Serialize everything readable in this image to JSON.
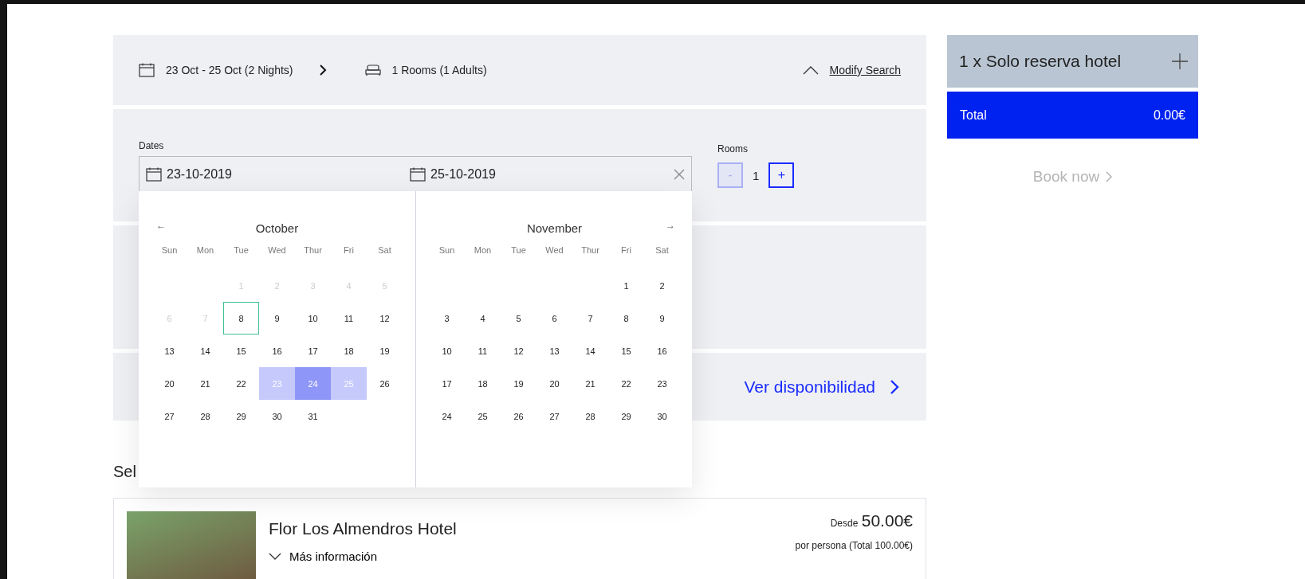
{
  "summary": {
    "dates": "23 Oct - 25 Oct (2 Nights)",
    "rooms": "1 Rooms (1 Adults)",
    "modify": "Modify Search"
  },
  "search": {
    "dates_label": "Dates",
    "start": "23-10-2019",
    "end": "25-10-2019",
    "rooms": {
      "label": "Rooms",
      "value": "1",
      "decrement": {
        "label": "-",
        "disabled": true
      },
      "increment": {
        "label": "+",
        "disabled": false
      }
    }
  },
  "calendar": {
    "months": [
      {
        "name": "October",
        "nav": {
          "label": "←",
          "kind": "prev"
        },
        "weekdays": [
          "Sun",
          "Mon",
          "Tue",
          "Wed",
          "Thur",
          "Fri",
          "Sat"
        ],
        "weeks": [
          [
            {
              "kind": "blank"
            },
            {
              "kind": "blank"
            },
            {
              "label": "1",
              "kind": "past"
            },
            {
              "label": "2",
              "kind": "past"
            },
            {
              "label": "3",
              "kind": "past"
            },
            {
              "label": "4",
              "kind": "past"
            },
            {
              "label": "5",
              "kind": "past"
            }
          ],
          [
            {
              "label": "6",
              "kind": "past"
            },
            {
              "label": "7",
              "kind": "past"
            },
            {
              "label": "8",
              "kind": "today"
            },
            {
              "label": "9",
              "kind": "day"
            },
            {
              "label": "10",
              "kind": "day"
            },
            {
              "label": "11",
              "kind": "day"
            },
            {
              "label": "12",
              "kind": "day"
            }
          ],
          [
            {
              "label": "13",
              "kind": "day"
            },
            {
              "label": "14",
              "kind": "day"
            },
            {
              "label": "15",
              "kind": "day"
            },
            {
              "label": "16",
              "kind": "day"
            },
            {
              "label": "17",
              "kind": "day"
            },
            {
              "label": "18",
              "kind": "day"
            },
            {
              "label": "19",
              "kind": "day"
            }
          ],
          [
            {
              "label": "20",
              "kind": "day"
            },
            {
              "label": "21",
              "kind": "day"
            },
            {
              "label": "22",
              "kind": "day"
            },
            {
              "label": "23",
              "kind": "range"
            },
            {
              "label": "24",
              "kind": "range_mid"
            },
            {
              "label": "25",
              "kind": "range"
            },
            {
              "label": "26",
              "kind": "day"
            }
          ],
          [
            {
              "label": "27",
              "kind": "day"
            },
            {
              "label": "28",
              "kind": "day"
            },
            {
              "label": "29",
              "kind": "day"
            },
            {
              "label": "30",
              "kind": "day"
            },
            {
              "label": "31",
              "kind": "day"
            }
          ]
        ]
      },
      {
        "name": "November",
        "nav": {
          "label": "→",
          "kind": "next"
        },
        "weekdays": [
          "Sun",
          "Mon",
          "Tue",
          "Wed",
          "Thur",
          "Fri",
          "Sat"
        ],
        "weeks": [
          [
            {
              "kind": "blank"
            },
            {
              "kind": "blank"
            },
            {
              "kind": "blank"
            },
            {
              "kind": "blank"
            },
            {
              "kind": "blank"
            },
            {
              "label": "1",
              "kind": "day"
            },
            {
              "label": "2",
              "kind": "day"
            }
          ],
          [
            {
              "label": "3",
              "kind": "day"
            },
            {
              "label": "4",
              "kind": "day"
            },
            {
              "label": "5",
              "kind": "day"
            },
            {
              "label": "6",
              "kind": "day"
            },
            {
              "label": "7",
              "kind": "day"
            },
            {
              "label": "8",
              "kind": "day"
            },
            {
              "label": "9",
              "kind": "day"
            }
          ],
          [
            {
              "label": "10",
              "kind": "day"
            },
            {
              "label": "11",
              "kind": "day"
            },
            {
              "label": "12",
              "kind": "day"
            },
            {
              "label": "13",
              "kind": "day"
            },
            {
              "label": "14",
              "kind": "day"
            },
            {
              "label": "15",
              "kind": "day"
            },
            {
              "label": "16",
              "kind": "day"
            }
          ],
          [
            {
              "label": "17",
              "kind": "day"
            },
            {
              "label": "18",
              "kind": "day"
            },
            {
              "label": "19",
              "kind": "day"
            },
            {
              "label": "20",
              "kind": "day"
            },
            {
              "label": "21",
              "kind": "day"
            },
            {
              "label": "22",
              "kind": "day"
            },
            {
              "label": "23",
              "kind": "day"
            }
          ],
          [
            {
              "label": "24",
              "kind": "day"
            },
            {
              "label": "25",
              "kind": "day"
            },
            {
              "label": "26",
              "kind": "day"
            },
            {
              "label": "27",
              "kind": "day"
            },
            {
              "label": "28",
              "kind": "day"
            },
            {
              "label": "29",
              "kind": "day"
            },
            {
              "label": "30",
              "kind": "day"
            }
          ]
        ]
      }
    ]
  },
  "availability": {
    "label": "Ver disponibilidad"
  },
  "section_heading": "Sel",
  "hotel": {
    "name": "Flor Los Almendros Hotel",
    "more": "Más información",
    "from": "Desde",
    "price": "50.00€",
    "per_person": "por persona (Total 100.00€)"
  },
  "cart": {
    "item": "1 x Solo reserva hotel",
    "total_label": "Total",
    "total": "0.00€",
    "book": {
      "label": "Book now",
      "disabled": true
    }
  }
}
